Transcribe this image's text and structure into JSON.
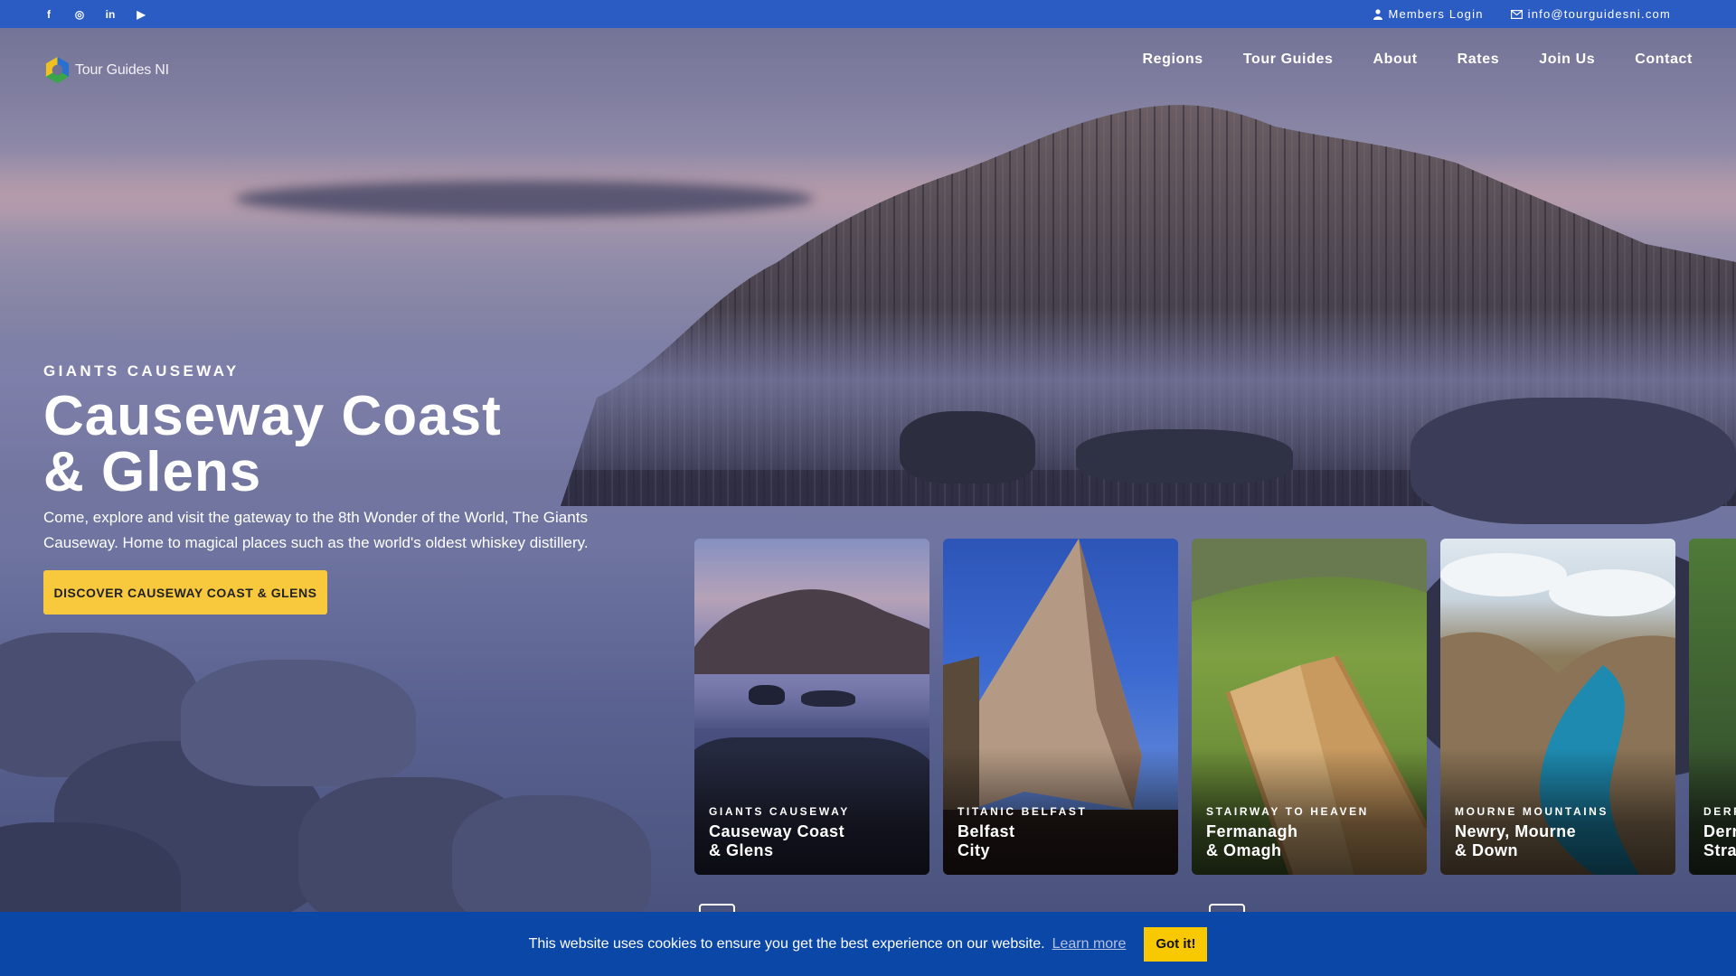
{
  "topbar": {
    "social": [
      {
        "icon": "facebook-icon",
        "glyph": "f"
      },
      {
        "icon": "instagram-icon",
        "glyph": "◎"
      },
      {
        "icon": "linkedin-icon",
        "glyph": "in"
      },
      {
        "icon": "youtube-icon",
        "glyph": "▶"
      }
    ],
    "members_login": "Members Login",
    "email": "info@tourguidesni.com"
  },
  "logo": {
    "text": "Tour Guides NI"
  },
  "nav": [
    "Regions",
    "Tour Guides",
    "About",
    "Rates",
    "Join Us",
    "Contact"
  ],
  "hero": {
    "eyebrow": "GIANTS CAUSEWAY",
    "title_line1": "Causeway Coast",
    "title_line2": "& Glens",
    "description": "Come, explore and visit the gateway to the 8th Wonder of the World, The Giants Causeway. Home to magical places such as the world's oldest whiskey distillery.",
    "cta": "DISCOVER CAUSEWAY COAST & GLENS"
  },
  "cards": [
    {
      "kicker": "GIANTS CAUSEWAY",
      "line1": "Causeway Coast",
      "line2": "& Glens"
    },
    {
      "kicker": "TITANIC BELFAST",
      "line1": "Belfast",
      "line2": "City"
    },
    {
      "kicker": "STAIRWAY TO HEAVEN",
      "line1": "Fermanagh",
      "line2": "& Omagh"
    },
    {
      "kicker": "MOURNE MOUNTAINS",
      "line1": "Newry, Mourne",
      "line2": "& Down"
    },
    {
      "kicker": "DERRY",
      "line1": "Derry",
      "line2": "Strabane"
    }
  ],
  "cookie": {
    "message": "This website uses cookies to ensure you get the best experience on our website.",
    "learn_more": "Learn more",
    "accept": "Got it!"
  },
  "colors": {
    "topbar": "#2b5cc4",
    "cta": "#f8c93d",
    "cookie_bar": "#0b47a7",
    "cookie_button": "#f8c800"
  }
}
